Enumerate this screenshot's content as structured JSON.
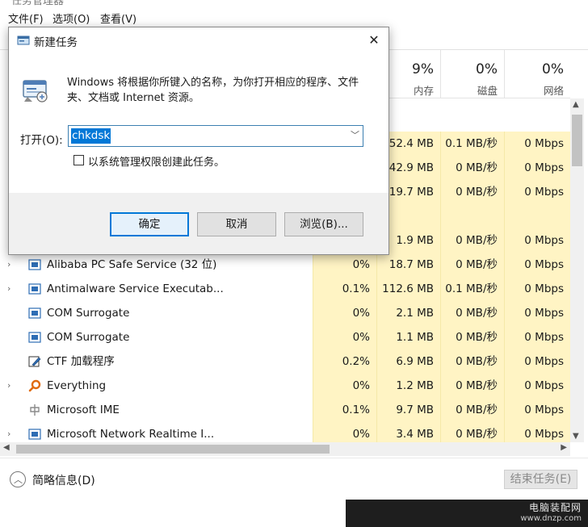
{
  "task_manager": {
    "title_fragment": "任务管理器",
    "menu": [
      "文件(F)",
      "选项(O)",
      "查看(V)"
    ],
    "columns": [
      {
        "percent": "9%",
        "name": "内存"
      },
      {
        "percent": "0%",
        "name": "磁盘"
      },
      {
        "percent": "0%",
        "name": "网络"
      }
    ],
    "rows": [
      {
        "name": "",
        "cpu": "",
        "mem": "152.4 MB",
        "disk": "0.1 MB/秒",
        "net": "0 Mbps"
      },
      {
        "name": "",
        "cpu": "",
        "mem": "42.9 MB",
        "disk": "0 MB/秒",
        "net": "0 Mbps"
      },
      {
        "name": "",
        "cpu": "",
        "mem": "19.7 MB",
        "disk": "0 MB/秒",
        "net": "0 Mbps"
      },
      {
        "name": "",
        "cpu": "",
        "mem": "",
        "disk": "",
        "net": ""
      },
      {
        "name": "",
        "cpu": "",
        "mem": "1.9 MB",
        "disk": "0 MB/秒",
        "net": "0 Mbps"
      },
      {
        "name": "Alibaba PC Safe Service (32 位)",
        "expander": "›",
        "icon": "service-icon",
        "cpu": "0%",
        "mem": "18.7 MB",
        "disk": "0 MB/秒",
        "net": "0 Mbps"
      },
      {
        "name": "Antimalware Service Executab...",
        "expander": "›",
        "icon": "service-icon",
        "cpu": "0.1%",
        "mem": "112.6 MB",
        "disk": "0.1 MB/秒",
        "net": "0 Mbps"
      },
      {
        "name": "COM Surrogate",
        "expander": "",
        "icon": "service-icon",
        "cpu": "0%",
        "mem": "2.1 MB",
        "disk": "0 MB/秒",
        "net": "0 Mbps"
      },
      {
        "name": "COM Surrogate",
        "expander": "",
        "icon": "service-icon",
        "cpu": "0%",
        "mem": "1.1 MB",
        "disk": "0 MB/秒",
        "net": "0 Mbps"
      },
      {
        "name": "CTF 加载程序",
        "expander": "",
        "icon": "ctf-pen-icon",
        "cpu": "0.2%",
        "mem": "6.9 MB",
        "disk": "0 MB/秒",
        "net": "0 Mbps"
      },
      {
        "name": "Everything",
        "expander": "›",
        "icon": "magnifier-icon",
        "cpu": "0%",
        "mem": "1.2 MB",
        "disk": "0 MB/秒",
        "net": "0 Mbps"
      },
      {
        "name": "Microsoft IME",
        "expander": "",
        "icon": "ime-icon",
        "cpu": "0.1%",
        "mem": "9.7 MB",
        "disk": "0 MB/秒",
        "net": "0 Mbps"
      },
      {
        "name": "Microsoft Network Realtime I...",
        "expander": "›",
        "icon": "service-icon",
        "cpu": "0%",
        "mem": "3.4 MB",
        "disk": "0 MB/秒",
        "net": "0 Mbps"
      }
    ],
    "fewer_details": "简略信息(D)",
    "end_task": "结束任务(E)",
    "watermark_line1": "电脑装配网",
    "watermark_line2": "www.dnzp.com"
  },
  "run_dialog": {
    "title": "新建任务",
    "close_glyph": "✕",
    "description": "Windows 将根据你所键入的名称，为你打开相应的程序、文件夹、文档或 Internet 资源。",
    "open_label": "打开(O):",
    "input_value": "chkdsk",
    "admin_checkbox_label": "以系统管理权限创建此任务。",
    "admin_checked": false,
    "ok": "确定",
    "cancel": "取消",
    "browse": "浏览(B)..."
  },
  "colors": {
    "accent": "#0078d7",
    "heat_cell": "#fff4c4"
  }
}
